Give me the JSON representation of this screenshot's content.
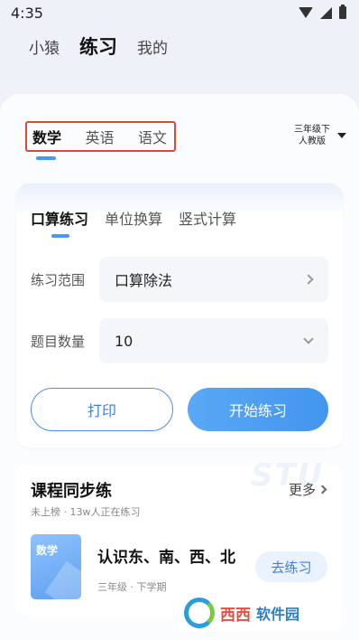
{
  "status": {
    "time": "4:35"
  },
  "top_nav": {
    "tabs": [
      "小猿",
      "练习",
      "我的"
    ],
    "active": "练习"
  },
  "subjects": {
    "tabs": [
      "数学",
      "英语",
      "语文"
    ],
    "active": "数学"
  },
  "grade": {
    "line1": "三年级下",
    "line2": "人教版"
  },
  "practice": {
    "modes": [
      "口算练习",
      "单位换算",
      "竖式计算"
    ],
    "active_mode": "口算练习",
    "range_label": "练习范围",
    "range_value": "口算除法",
    "count_label": "题目数量",
    "count_value": "10",
    "print_label": "打印",
    "start_label": "开始练习"
  },
  "sync": {
    "title": "课程同步练",
    "more_label": "更多",
    "subtitle": "未上榜 · 13w人正在练习",
    "bg_text": "STU",
    "lesson": {
      "cover_label": "数学",
      "title": "认识东、南、西、北",
      "meta": "三年级 · 下学期",
      "go_label": "去练习"
    }
  },
  "watermark": {
    "name_a": "西西",
    "name_b": "软件园"
  },
  "colors": {
    "accent": "#4b96ef",
    "highlight_border": "#d94a3a"
  }
}
